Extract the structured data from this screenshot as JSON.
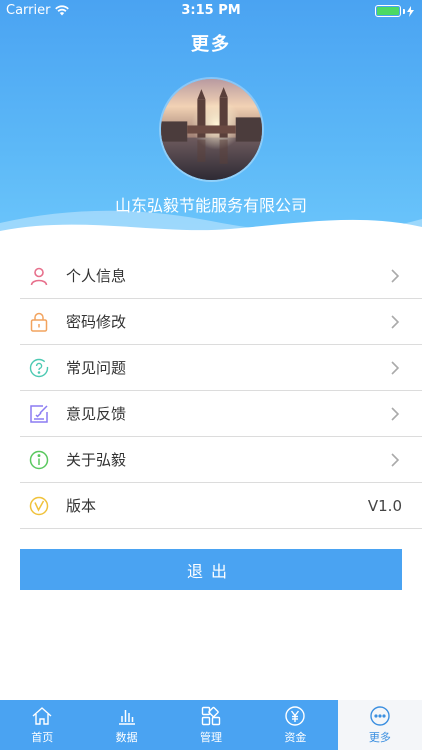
{
  "status_bar": {
    "carrier": "Carrier",
    "time": "3:15 PM"
  },
  "header": {
    "title": "更多",
    "company": "山东弘毅节能服务有限公司"
  },
  "menu": {
    "items": [
      {
        "label": "个人信息",
        "icon": "user-icon",
        "color": "#e7708c"
      },
      {
        "label": "密码修改",
        "icon": "lock-icon",
        "color": "#f2a35e"
      },
      {
        "label": "常见问题",
        "icon": "question-icon",
        "color": "#4cc9b2"
      },
      {
        "label": "意见反馈",
        "icon": "feedback-icon",
        "color": "#8b7cf2"
      },
      {
        "label": "关于弘毅",
        "icon": "info-icon",
        "color": "#5ac85f"
      },
      {
        "label": "版本",
        "icon": "version-icon",
        "color": "#f0c23b",
        "value": "V1.0"
      }
    ]
  },
  "logout": {
    "label": "退出"
  },
  "tabbar": {
    "tabs": [
      {
        "label": "首页",
        "icon": "home-icon"
      },
      {
        "label": "数据",
        "icon": "bar-chart-icon"
      },
      {
        "label": "管理",
        "icon": "grid-icon"
      },
      {
        "label": "资金",
        "icon": "yen-icon"
      },
      {
        "label": "更多",
        "icon": "more-icon",
        "active": true
      }
    ]
  },
  "colors": {
    "primary": "#4aa3f2",
    "tab_active_bg": "#f4f6f9"
  }
}
